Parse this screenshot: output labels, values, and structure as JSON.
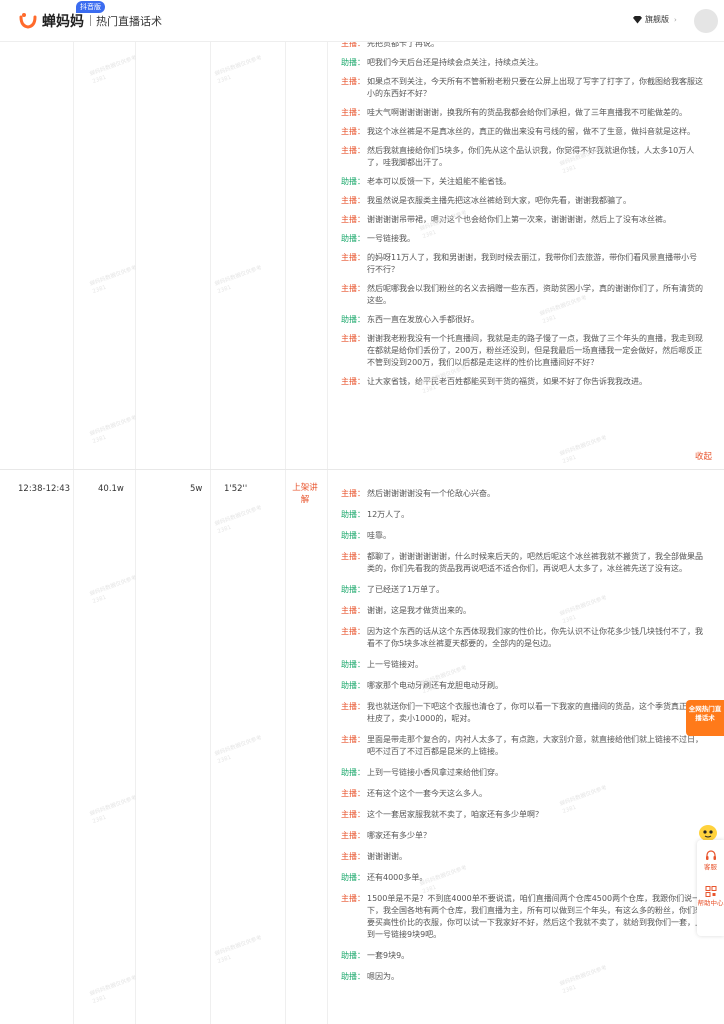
{
  "header": {
    "brand": "蝉妈妈",
    "brand_tag": "抖音版",
    "page_title": "热门直播话术",
    "vip_label": "旗舰版",
    "vip_caret": "›"
  },
  "colors": {
    "accent": "#e8542d",
    "assistant": "#1aa86b",
    "promo": "#ff7a1a"
  },
  "watermark": {
    "line1": "蝉妈妈数据仅供参考",
    "line2": "2381"
  },
  "block1": {
    "lines": [
      {
        "role": "主播：",
        "type": "host",
        "text": "先把货都卡了再说。"
      },
      {
        "role": "助播：",
        "type": "assistant",
        "text": "吧我们今天后台还是持续会点关注，持续点关注。"
      },
      {
        "role": "主播：",
        "type": "host",
        "text": "如果点不到关注，今天所有不管新粉老粉只要在公屏上出现了写字了打字了，你截图给我客服这小的东西好不好？"
      },
      {
        "role": "主播：",
        "type": "host",
        "text": "哇大气啊谢谢谢谢谢，换我所有的货品我都会给你们承担，做了三年直播我不可能做差的。"
      },
      {
        "role": "主播：",
        "type": "host",
        "text": "我这个冰丝裤是不是真冰丝的，真正的做出来没有弓线的留，做不了生意，做抖音就是这样。"
      },
      {
        "role": "主播：",
        "type": "host",
        "text": "然后我就直接给你们5块多，你们先从这个品认识我，你觉得不好我就退你钱，人太多10万人了，哇我脚都出汗了。"
      },
      {
        "role": "助播：",
        "type": "assistant",
        "text": "老本可以反馈一下，关注姐能不能省钱。"
      },
      {
        "role": "主播：",
        "type": "host",
        "text": "我虽然说是衣服类主播先把这冰丝裤给到大家，吧你先看，谢谢我都骗了。"
      },
      {
        "role": "主播：",
        "type": "host",
        "text": "谢谢谢谢吊带裙，嗯对这个也会给你们上第一次来，谢谢谢谢，然后上了没有冰丝裤。"
      },
      {
        "role": "助播：",
        "type": "assistant",
        "text": "一号链接我。"
      },
      {
        "role": "主播：",
        "type": "host",
        "text": "的妈呀11万人了，我和男谢谢，我到时候去丽江，我带你们去旅游，带你们看风景直播带小号行不行？"
      },
      {
        "role": "主播：",
        "type": "host",
        "text": "然后呢哪我会以我们粉丝的名义去捐赠一些东西，资助贫困小学，真的谢谢你们了，所有清货的这些。"
      },
      {
        "role": "助播：",
        "type": "assistant",
        "text": "东西一直在发放心入手都很好。"
      },
      {
        "role": "主播：",
        "type": "host",
        "text": "谢谢我老粉我没有一个托直播间，我就是走的路子慢了一点，我做了三个年头的直播，我走到现在都就是给你们丢份了，200万，粉丝还没到，但是我最后一场直播我一定会做好，然后嗯反正不管到没到200万，我们以后都是走这样的性价比直播间好不好？"
      },
      {
        "role": "主播：",
        "type": "host",
        "text": "让大家省钱，给平民老百姓都能买到干货的福货，如果不好了你告诉我我改进。"
      }
    ],
    "collapse_label": "收起"
  },
  "row2": {
    "time": "12:38-12:43",
    "viewers": "40.1w",
    "likes": "5w",
    "duration": "1'52''",
    "action_label": "上架讲解"
  },
  "block2": {
    "lines": [
      {
        "role": "主播：",
        "type": "host",
        "text": "然后谢谢谢谢没有一个伦敌心兴奋。"
      },
      {
        "role": "助播：",
        "type": "assistant",
        "text": "12万人了。"
      },
      {
        "role": "助播：",
        "type": "assistant",
        "text": "哇靠。"
      },
      {
        "role": "主播：",
        "type": "host",
        "text": "都聊了，谢谢谢谢谢谢，什么时候来后天的，吧然后呢这个冰丝裤我就不搬货了，我全部做果品类的，你们先看我的货品我再说吧适不适合你们，再说吧人太多了，冰丝裤先送了没有这。"
      },
      {
        "role": "助播：",
        "type": "assistant",
        "text": "了已经送了1万单了。"
      },
      {
        "role": "主播：",
        "type": "host",
        "text": "谢谢，这是我才做货出来的。"
      },
      {
        "role": "主播：",
        "type": "host",
        "text": "因为这个东西的话从这个东西体现我们家的性价比，你先认识不让你花多少钱几块钱付不了，我看不了你5块多冰丝裤夏天都要的，全部内的是包边。"
      },
      {
        "role": "助播：",
        "type": "assistant",
        "text": "上一号链接对。"
      },
      {
        "role": "助播：",
        "type": "assistant",
        "text": "哪家那个电动牙刷还有龙胆电动牙刷。"
      },
      {
        "role": "主播：",
        "type": "host",
        "text": "我也就送你们一下吧这个衣服也清仓了，你可以看一下我家的直播间的货品，这个季货真正的是柱皮了，卖小1000的，呢对。"
      },
      {
        "role": "主播：",
        "type": "host",
        "text": "里面是带走那个复合的，内衬人太多了，有点跑，大家别介意，就直接给他们就上链接不过日，吧不过百了不过百都是昆米的上链接。"
      },
      {
        "role": "助播：",
        "type": "assistant",
        "text": "上到一号链接小香风拿过来给他们穿。"
      },
      {
        "role": "主播：",
        "type": "host",
        "text": "还有这个这个一套今天这么多人。"
      },
      {
        "role": "主播：",
        "type": "host",
        "text": "这个一套居家服我就不卖了，咱家还有多少单啊？"
      },
      {
        "role": "主播：",
        "type": "host",
        "text": "哪家还有多少单？"
      },
      {
        "role": "主播：",
        "type": "host",
        "text": "谢谢谢谢。"
      },
      {
        "role": "助播：",
        "type": "assistant",
        "text": "还有4000多单。"
      },
      {
        "role": "主播：",
        "type": "host",
        "text": "1500单是不是？不到底4000单不要说谎，咱们直播间两个仓库4500两个仓库，我跟你们说一下，我全国各地有两个仓库，我们直播为主，所有可以做到三个年头，有这么多的粉丝，你们想要买高性价比的衣服，你可以试一下我家好不好，然后这个我就不卖了，就给到我你们一套，上到一号链接9块9吧。"
      },
      {
        "role": "助播：",
        "type": "assistant",
        "text": "一套9块9。"
      },
      {
        "role": "助播：",
        "type": "assistant",
        "text": "嗯因为。"
      }
    ]
  },
  "promo": {
    "label": "全网热门直播话术"
  },
  "side": {
    "service_label": "客服",
    "help_label": "帮助中心"
  }
}
